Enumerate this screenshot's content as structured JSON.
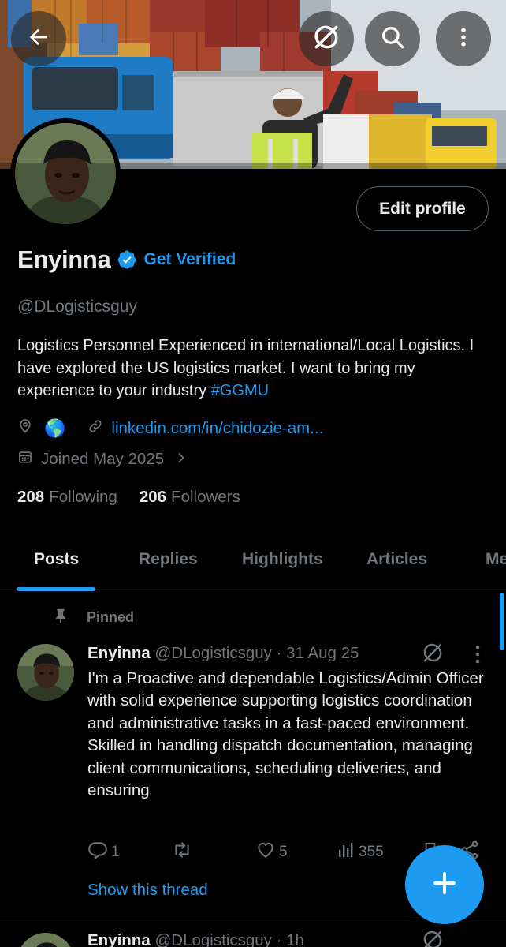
{
  "header": {
    "back_icon": "arrow-left-icon",
    "grok_icon": "grok-icon",
    "search_icon": "search-icon",
    "more_icon": "more-vertical-icon"
  },
  "profile": {
    "name": "Enyinna",
    "get_verified": "Get Verified",
    "handle": "@DLogisticsguy",
    "edit_profile": "Edit profile",
    "bio_text": "Logistics Personnel Experienced in international/Local Logistics. I have explored the US logistics market.  I want to bring my experience to your industry ",
    "bio_hashtag": "#GGMU",
    "location_emoji": "🌎",
    "website": "linkedin.com/in/chidozie-am...",
    "joined": "Joined May 2025",
    "following_count": "208",
    "following_label": "Following",
    "followers_count": "206",
    "followers_label": "Followers"
  },
  "tabs": [
    {
      "label": "Posts"
    },
    {
      "label": "Replies"
    },
    {
      "label": "Highlights"
    },
    {
      "label": "Articles"
    },
    {
      "label": "Me"
    }
  ],
  "pinned_post": {
    "pinned_label": "Pinned",
    "author_name": "Enyinna",
    "author_handle": "@DLogisticsguy",
    "separator": " · ",
    "date": "31 Aug 25",
    "text": "I'm a Proactive and dependable Logistics/Admin Officer with solid experience supporting logistics coordination and  administrative tasks in a fast-paced environment. Skilled in handling dispatch documentation, managing client communications, scheduling deliveries, and ensuring",
    "replies": "1",
    "reposts": "",
    "likes": "5",
    "views": "355",
    "show_thread": "Show this thread"
  },
  "second_post": {
    "author_name": "Enyinna",
    "author_handle": "@DLogisticsguy",
    "separator": " · ",
    "time": "1h"
  },
  "colors": {
    "background": "#000000",
    "accent": "#1d9bf0",
    "text_primary": "#e7e9ea",
    "text_secondary": "#71767b",
    "border": "#2f3336"
  }
}
